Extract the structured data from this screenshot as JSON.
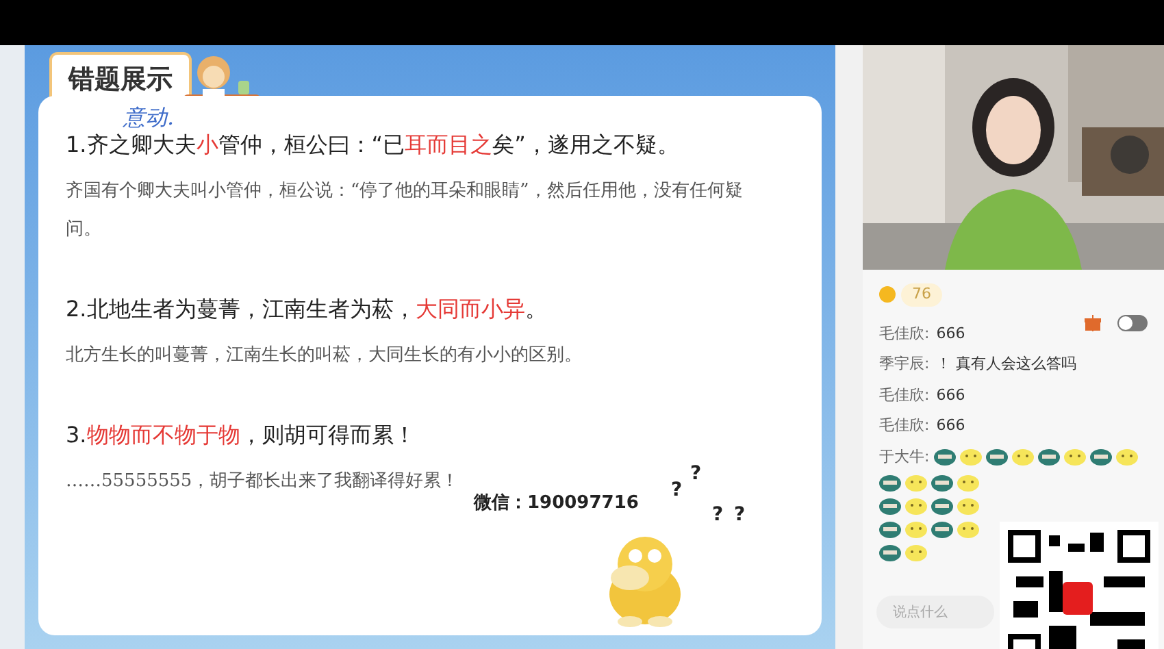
{
  "slide": {
    "title": "错题展示",
    "annotation": "意动.",
    "items": [
      {
        "line": [
          {
            "text": "1.齐之卿大夫",
            "highlight": false
          },
          {
            "text": "小",
            "highlight": true
          },
          {
            "text": "管仲，桓公曰：“已",
            "highlight": false
          },
          {
            "text": "耳而目之",
            "highlight": true
          },
          {
            "text": "矣”，遂用之不疑。",
            "highlight": false
          }
        ],
        "translation": "齐国有个卿大夫叫小管仲，桓公说：“停了他的耳朵和眼睛”，然后任用他，没有任何疑问。"
      },
      {
        "line": [
          {
            "text": "2.北地生者为蔓菁，江南生者为菘，",
            "highlight": false
          },
          {
            "text": "大同而小异",
            "highlight": true
          },
          {
            "text": "。",
            "highlight": false
          }
        ],
        "translation": "北方生长的叫蔓菁，江南生长的叫菘，大同生长的有小小的区别。"
      },
      {
        "line": [
          {
            "text": "3.",
            "highlight": false
          },
          {
            "text": "物物而不物于物",
            "highlight": true
          },
          {
            "text": "，则胡可得而累！",
            "highlight": false
          }
        ],
        "translation": "……55555555，胡子都长出来了我翻译得好累！"
      }
    ],
    "contact": "微信：190097716",
    "question_marks": [
      "?",
      "?",
      "?",
      "?"
    ]
  },
  "chat": {
    "coins": "76",
    "toggle_on": false,
    "messages": [
      {
        "user": "毛佳欣:",
        "text": "666"
      },
      {
        "user": "季宇辰:",
        "text": "！ 真有人会这么答吗"
      },
      {
        "user": "毛佳欣:",
        "text": "666"
      },
      {
        "user": "毛佳欣:",
        "text": "666"
      },
      {
        "user": "于大牛:",
        "emoji_lines": [
          [
            {
              "kind": "ninja"
            },
            {
              "kind": "lemon"
            },
            {
              "kind": "ninja"
            },
            {
              "kind": "lemon"
            },
            {
              "kind": "ninja"
            },
            {
              "kind": "lemon"
            },
            {
              "kind": "ninja"
            },
            {
              "kind": "lemon"
            }
          ],
          [
            {
              "kind": "ninja"
            },
            {
              "kind": "lemon"
            },
            {
              "kind": "ninja"
            },
            {
              "kind": "lemon"
            }
          ],
          [
            {
              "kind": "ninja"
            },
            {
              "kind": "lemon"
            },
            {
              "kind": "ninja"
            },
            {
              "kind": "lemon"
            }
          ],
          [
            {
              "kind": "ninja"
            },
            {
              "kind": "lemon"
            },
            {
              "kind": "ninja"
            },
            {
              "kind": "lemon"
            }
          ],
          [
            {
              "kind": "ninja"
            },
            {
              "kind": "lemon"
            }
          ]
        ]
      }
    ],
    "input": {
      "placeholder": "说点什么"
    }
  }
}
